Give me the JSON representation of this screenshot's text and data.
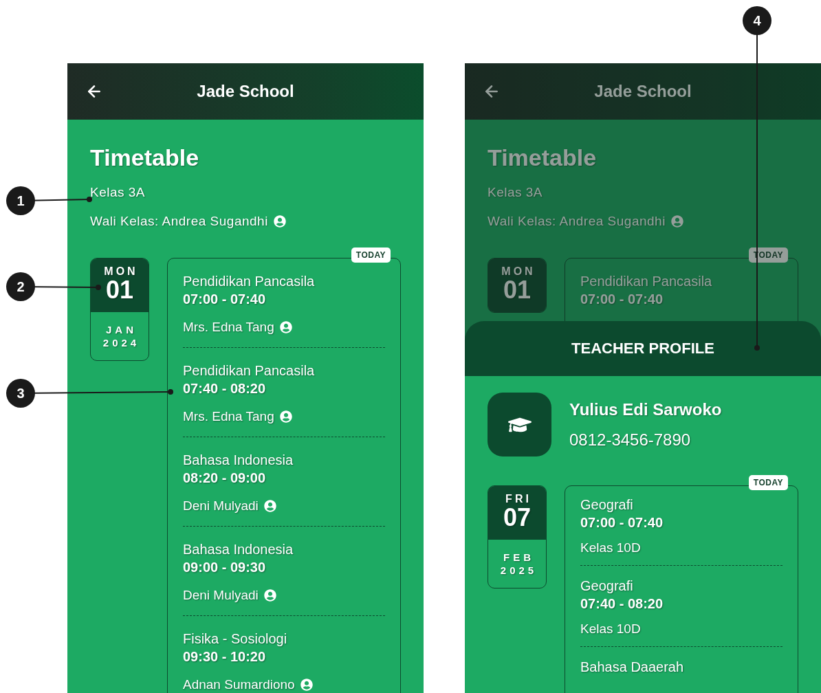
{
  "callouts": [
    {
      "label": "1"
    },
    {
      "label": "2"
    },
    {
      "label": "3"
    },
    {
      "label": "4"
    }
  ],
  "screens": [
    {
      "dimmed": false,
      "header": {
        "title": "Jade School"
      },
      "title": "Timetable",
      "class_name": "Kelas 3A",
      "homeroom": "Wali Kelas: Andrea Sugandhi",
      "days": [
        {
          "weekday": "MON",
          "day": "01",
          "month": "JAN",
          "year": "2024",
          "badge": "TODAY",
          "lessons": [
            {
              "subject": "Pendidikan Pancasila",
              "time": "07:00 - 07:40",
              "detail": "Mrs. Edna Tang",
              "kind": "teacher"
            },
            {
              "subject": "Pendidikan Pancasila",
              "time": "07:40 - 08:20",
              "detail": "Mrs. Edna Tang",
              "kind": "teacher"
            },
            {
              "subject": "Bahasa Indonesia",
              "time": "08:20 - 09:00",
              "detail": "Deni Mulyadi",
              "kind": "teacher"
            },
            {
              "subject": "Bahasa Indonesia",
              "time": "09:00 - 09:30",
              "detail": "Deni Mulyadi",
              "kind": "teacher"
            },
            {
              "subject": "Fisika - Sosiologi",
              "time": "09:30 - 10:20",
              "detail": "Adnan Sumardiono",
              "kind": "teacher"
            }
          ]
        }
      ]
    },
    {
      "dimmed": true,
      "header": {
        "title": "Jade School"
      },
      "title": "Timetable",
      "class_name": "Kelas 3A",
      "homeroom": "Wali Kelas: Andrea Sugandhi",
      "days": [
        {
          "weekday": "MON",
          "day": "01",
          "badge": "TODAY",
          "lessons": [
            {
              "subject": "Pendidikan Pancasila",
              "time": "07:00 - 07:40"
            }
          ]
        }
      ],
      "sheet": {
        "title": "TEACHER PROFILE",
        "teacher": {
          "name": "Yulius Edi Sarwoko",
          "phone": "0812-3456-7890"
        },
        "days": [
          {
            "weekday": "FRI",
            "day": "07",
            "month": "FEB",
            "year": "2025",
            "badge": "TODAY",
            "lessons": [
              {
                "subject": "Geografi",
                "time": "07:00 - 07:40",
                "detail": "Kelas 10D",
                "kind": "class"
              },
              {
                "subject": "Geografi",
                "time": "07:40 - 08:20",
                "detail": "Kelas 10D",
                "kind": "class"
              },
              {
                "subject": "Bahasa Daaerah"
              }
            ]
          }
        ]
      }
    }
  ]
}
